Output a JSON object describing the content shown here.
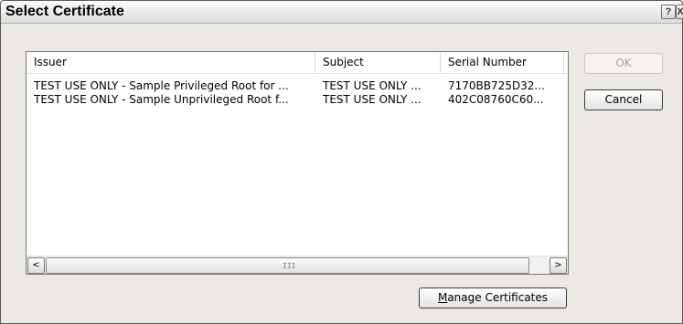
{
  "dialog": {
    "title": "Select Certificate",
    "help_glyph": "?",
    "close_glyph": "X"
  },
  "list": {
    "columns": [
      "Issuer",
      "Subject",
      "Serial Number"
    ],
    "rows": [
      {
        "issuer": "TEST USE ONLY - Sample Privileged Root for ...",
        "subject": "TEST USE ONLY ...",
        "serial": "7170BB725D32..."
      },
      {
        "issuer": "TEST USE ONLY - Sample Unprivileged Root f...",
        "subject": "TEST USE ONLY ...",
        "serial": "402C08760C60..."
      }
    ],
    "scroll_left_glyph": "<",
    "scroll_right_glyph": ">",
    "scroll_grip": "III"
  },
  "buttons": {
    "ok_label": "OK",
    "cancel_label": "Cancel",
    "manage_mnemonic": "M",
    "manage_rest": "anage Certificates"
  }
}
